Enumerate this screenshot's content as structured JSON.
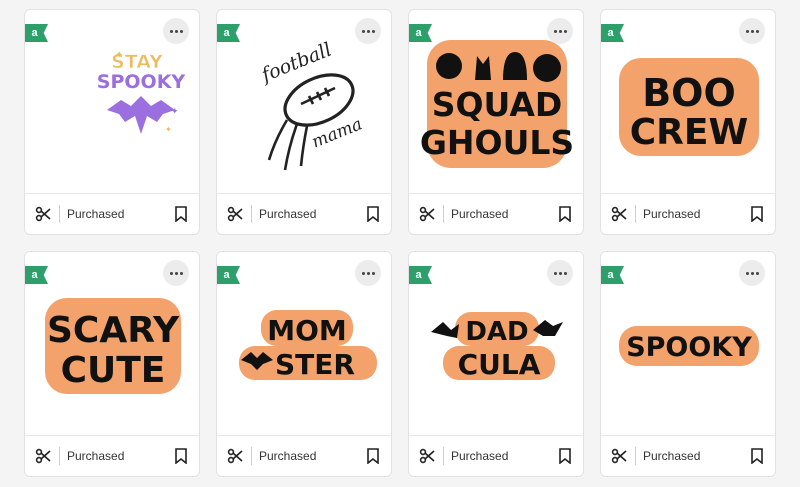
{
  "footer_label": "Purchased",
  "badge_letter": "a",
  "icons": {
    "cut": "scissors-icon",
    "save": "bookmark-icon",
    "more": "more-icon"
  },
  "colors": {
    "badge": "#2e9e6a",
    "orange": "#f2a26a",
    "moon": "#f0b95a",
    "purple": "#9b6fe0"
  },
  "cards": [
    {
      "lines": [
        "STAY",
        "SPOOKY"
      ]
    },
    {
      "lines": [
        "football",
        "mama"
      ]
    },
    {
      "lines": [
        "SQUAD",
        "GHOULS"
      ]
    },
    {
      "lines": [
        "BOO",
        "CREW"
      ]
    },
    {
      "lines": [
        "SCARY",
        "CUTE"
      ]
    },
    {
      "lines": [
        "MOM",
        "STER"
      ]
    },
    {
      "lines": [
        "DAD",
        "CULA"
      ]
    },
    {
      "lines": [
        "SPOOKY"
      ]
    }
  ]
}
